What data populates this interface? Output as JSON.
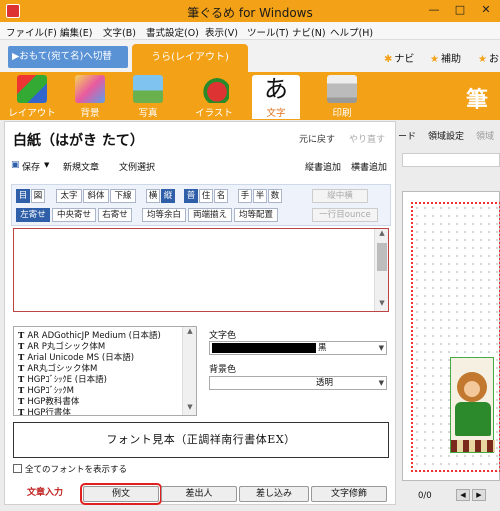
{
  "window": {
    "title": "筆ぐるめ for Windows",
    "controls": [
      "—",
      "□",
      "✕"
    ]
  },
  "menu": [
    "ファイル(F)",
    "編集(E)",
    "文字(B)",
    "書式設定(O)",
    "表示(V)",
    "ツール(T)",
    "ナビ(N)",
    "ヘルプ(H)"
  ],
  "tabs": {
    "switch_label": "▶おもて(宛て名)へ切替",
    "layout_label": "うら(レイアウト)",
    "navi": "ナビ",
    "help": "補助",
    "partial": "お"
  },
  "toolbar": {
    "items": [
      "レイアウト",
      "背景",
      "写真",
      "イラスト",
      "文字",
      "印刷"
    ],
    "brand": "筆ぐ"
  },
  "panel": {
    "title": "白紙（はがき たて）",
    "undo": "元に戻す",
    "redo": "やり直す",
    "save": "保存",
    "new_text": "新規文章",
    "select_text": "文例選択",
    "add_vertical": "縦書追加",
    "add_horizontal": "横書追加"
  },
  "format": {
    "row1": [
      "目",
      "図",
      "太字",
      "斜体",
      "下線",
      "横",
      "縦",
      "普",
      "住",
      "名",
      "手",
      "半",
      "数",
      "縦中横"
    ],
    "row2": [
      "左寄せ",
      "中央寄せ",
      "右寄せ",
      "均等余白",
      "両端揃え",
      "均等配置",
      "一行目ounce"
    ]
  },
  "fonts": {
    "items": [
      "AR ADGothicJP Medium (日本語)",
      "AR P丸ゴシック体M",
      "Arial Unicode MS (日本語)",
      "AR丸ゴシック体M",
      "HGPｺﾞｼｯｸE (日本語)",
      "HGPｺﾞｼｯｸM",
      "HGP教科書体",
      "HGP行書体"
    ],
    "text_color_label": "文字色",
    "text_color_value": "黒",
    "bg_color_label": "背景色",
    "bg_color_value": "透明",
    "preview": "フォント見本（正調祥南行書体EX）",
    "show_all": "全てのフォントを表示する"
  },
  "bottom_tabs": [
    "文章入力",
    "例文",
    "差出人",
    "差し込み",
    "文字修飾"
  ],
  "right": {
    "links": [
      "ード",
      "領域設定",
      "領域"
    ],
    "page_count": "0/0"
  }
}
